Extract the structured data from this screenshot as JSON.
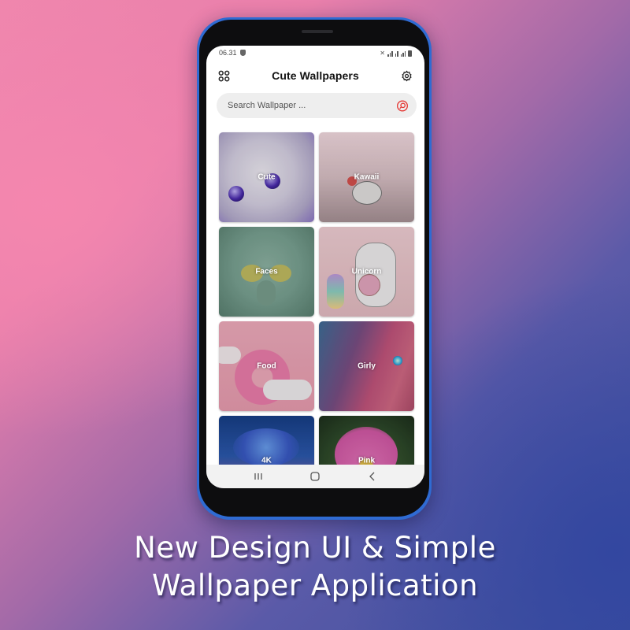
{
  "status_bar": {
    "time": "06.31"
  },
  "header": {
    "title": "Cute Wallpapers",
    "menu_icon": "grid-menu-icon",
    "settings_icon": "gear-icon"
  },
  "search": {
    "placeholder": "Search Wallpaper ...",
    "value": "",
    "icon": "search-icon",
    "accent_color": "#e53935"
  },
  "categories": [
    {
      "label": "Cute"
    },
    {
      "label": "Kawaii"
    },
    {
      "label": "Faces"
    },
    {
      "label": "Unicorn"
    },
    {
      "label": "Food"
    },
    {
      "label": "Girly"
    },
    {
      "label": "4K"
    },
    {
      "label": "Pink"
    }
  ],
  "nav_bar": {
    "recents_icon": "recents-icon",
    "home_icon": "home-icon",
    "back_icon": "back-icon"
  },
  "caption": {
    "line1": "New Design UI & Simple",
    "line2": "Wallpaper Application"
  }
}
